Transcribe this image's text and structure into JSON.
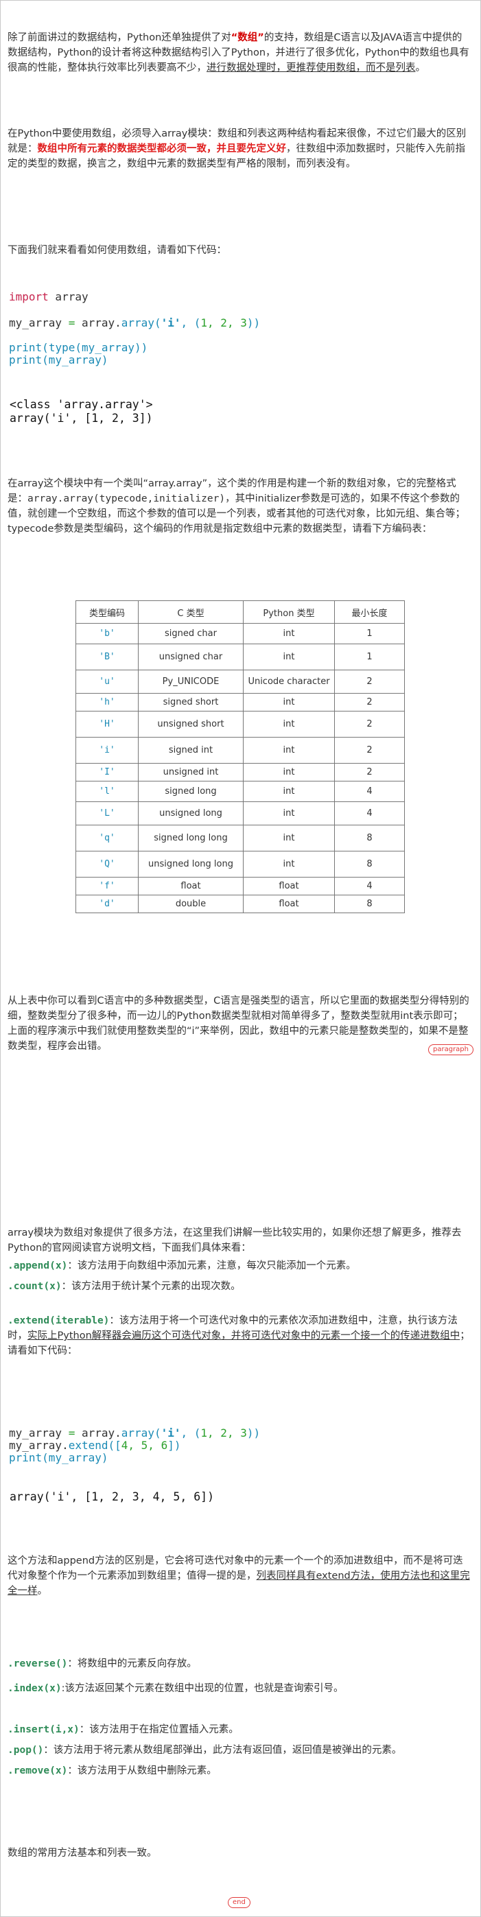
{
  "paragraphs": {
    "p1": {
      "a": "除了前面讲过的数据结构，Python还单独提供了对",
      "emph": "“数组”",
      "b": "的支持，数组是C语言以及JAVA语言中提供的数据结构，Python的设计者将这种数据结构引入了Python，并进行了很多优化，Python中的数组也具有很高的性能，整体执行效率比列表要高不少，",
      "underlined": "进行数据处理时，更推荐使用数组，而不是列表",
      "c": "。"
    },
    "p2": {
      "a": "在Python中要使用数组，必须导入array模块：数组和列表这两种结构看起来很像，不过它们最大的区别就是：",
      "red": "数组中所有元素的数据类型都必须一致，并且要先定义好",
      "b": "，往数组中添加数据时，只能传入先前指定的类型的数据，换言之，数组中元素的数据类型有严格的限制，而列表没有。"
    },
    "p3": "下面我们就来看看如何使用数组，请看如下代码：",
    "p4": {
      "a": "在array这个模块中有一个类叫“array.array”，这个类的作用是构建一个新的数组对象，它的完整格式是：",
      "code1": "array.array(typecode,initializer)",
      "b": "，其中initializer参数是可选的，如果不传这个参数的值，就创建一个空数组，而这个参数的值可以是一个列表，或者其他的可迭代对象，比如元组、集合等；typecode参数是类型编码，这个编码的作用就是指定数组中元素的数据类型，请看下方编码表："
    },
    "p5": "从上表中你可以看到C语言中的多种数据类型，C语言是强类型的语言，所以它里面的数据类型分得特别的细，整数类型分了很多种，而一边儿的Python数据类型就相对简单得多了，整数类型就用int表示即可；上面的程序演示中我们就使用整数类型的“i”来举例，因此，数组中的元素只能是整数类型的，如果不是整数类型，程序会出错。",
    "p6": "array模块为数组对象提供了很多方法，在这里我们讲解一些比较实用的，如果你还想了解更多，推荐去Python的官网阅读官方说明文档，下面我们具体来看：",
    "p7": "这个方法和append方法的区别是，它会将可迭代对象中的元素一个一个的添加进数组中，而不是将可迭代对象整个作为一个元素添加到数组里；值得一提的是，",
    "p7_u": "列表同样具有extend方法，使用方法也和这里完全一样",
    "p7_end": "。",
    "p8": "数组的常用方法基本和列表一致。"
  },
  "code1": {
    "l1_kw": "import",
    "l1_rest": " array",
    "l2_a": "my_array ",
    "l2_op": "=",
    "l2_b": " array.",
    "l2_fn": "array",
    "l2_c": "(",
    "l2_str": "'i'",
    "l2_d": ", (",
    "l2_n": "1, 2, 3",
    "l2_e": "))",
    "l3_fn": "print",
    "l3_a": "(",
    "l3_fn2": "type",
    "l3_b": "(my_array))",
    "l4_fn": "print",
    "l4_a": "(my_array)"
  },
  "output1": {
    "l1": "<class 'array.array'>",
    "l2": "array('i', [1, 2, 3])"
  },
  "table": {
    "headers": [
      "类型编码",
      "C 类型",
      "Python 类型",
      "最小长度"
    ],
    "rows": [
      [
        "'b'",
        "signed char",
        "int",
        "1"
      ],
      [
        "'B'",
        "unsigned char",
        "int",
        "1"
      ],
      [
        "'u'",
        "Py_UNICODE",
        "Unicode character",
        "2"
      ],
      [
        "'h'",
        "signed short",
        "int",
        "2"
      ],
      [
        "'H'",
        "unsigned short",
        "int",
        "2"
      ],
      [
        "'i'",
        "signed int",
        "int",
        "2"
      ],
      [
        "'I'",
        "unsigned int",
        "int",
        "2"
      ],
      [
        "'l'",
        "signed long",
        "int",
        "4"
      ],
      [
        "'L'",
        "unsigned long",
        "int",
        "4"
      ],
      [
        "'q'",
        "signed long long",
        "int",
        "8"
      ],
      [
        "'Q'",
        "unsigned long long",
        "int",
        "8"
      ],
      [
        "'f'",
        "float",
        "float",
        "4"
      ],
      [
        "'d'",
        "double",
        "float",
        "8"
      ]
    ]
  },
  "methods": {
    "append_name": ".append(x)",
    "append_desc": "：该方法用于向数组中添加元素，注意，每次只能添加一个元素。",
    "count_name": ".count(x)",
    "count_desc": "：该方法用于统计某个元素的出现次数。",
    "extend_name": ".extend(iterable)",
    "extend_desc_a": "：该方法用于将一个可迭代对象中的元素依次添加进数组中，注意，执行该方法时，",
    "extend_desc_u": "实际上Python解释器会遍历这个可迭代对象，并将可迭代对象中的元素一个接一个的传递进数组中",
    "extend_desc_b": "；请看如下代码：",
    "reverse_name": ".reverse()",
    "reverse_desc": "：将数组中的元素反向存放。",
    "index_name": ".index(x)",
    "index_desc": ":该方法返回某个元素在数组中出现的位置，也就是查询索引号。",
    "insert_name": ".insert(i,x)",
    "insert_desc": "：该方法用于在指定位置插入元素。",
    "pop_name": ".pop()",
    "pop_desc": "：该方法用于将元素从数组尾部弹出，此方法有返回值，返回值是被弹出的元素。",
    "remove_name": ".remove(x)",
    "remove_desc": "：该方法用于从数组中删除元素。"
  },
  "code2": {
    "l1_a": "my_array ",
    "l1_op": "=",
    "l1_b": " array.",
    "l1_fn": "array",
    "l1_c": "(",
    "l1_str": "'i'",
    "l1_d": ", (",
    "l1_n": "1, 2, 3",
    "l1_e": "))",
    "l2_a": "my_array.",
    "l2_fn": "extend",
    "l2_b": "([",
    "l2_n": "4, 5, 6",
    "l2_c": "])",
    "l3_fn": "print",
    "l3_a": "(my_array)"
  },
  "output2": "array('i', [1, 2, 3, 4, 5, 6])",
  "badges": {
    "paragraph": "paragraph",
    "end": "end"
  },
  "colors": {
    "keyword": "#c7254e",
    "function": "#1a8ab5",
    "number": "#2ca02c",
    "method": "#2e8b57",
    "emphasis_red": "#e01e1e",
    "badge": "#e23b3b"
  }
}
